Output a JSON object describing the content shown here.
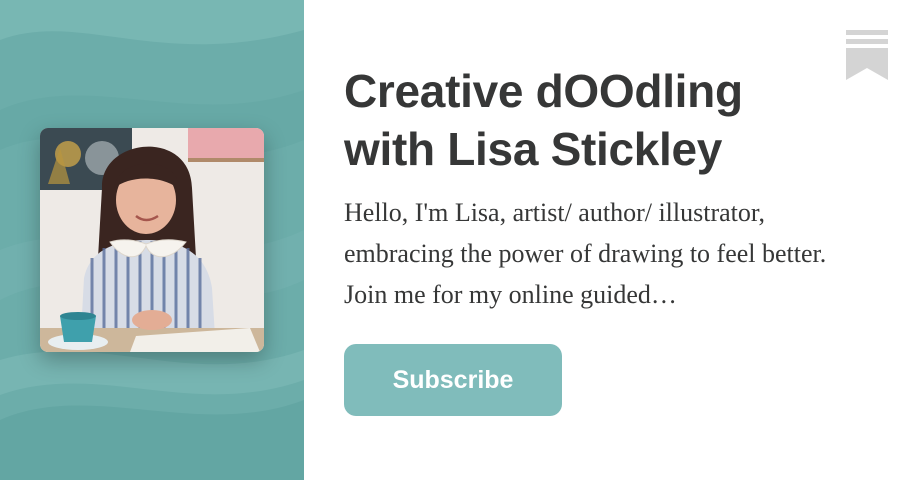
{
  "publication": {
    "title": "Creative dOOdling with Lisa Stickley",
    "description": "Hello, I'm Lisa, artist/ author/ illustrator, embracing the power of drawing to feel better. Join me for my online guided…",
    "subscribe_label": "Subscribe"
  },
  "colors": {
    "accent": "#80bcbb",
    "panel_background": "#6fb0ad",
    "text": "#363737",
    "bookmark": "#d4d4d4"
  },
  "icons": {
    "bookmark": "bookmark-icon"
  }
}
